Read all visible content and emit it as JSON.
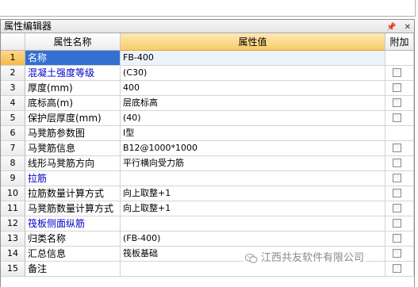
{
  "panel": {
    "title": "属性编辑器",
    "pin_icon": "pin-icon",
    "close_icon": "close-icon"
  },
  "table": {
    "headers": {
      "name": "属性名称",
      "value": "属性值",
      "add": "附加"
    },
    "rows": [
      {
        "num": "1",
        "name": "名称",
        "value": "FB-400",
        "link": true,
        "checkbox": false,
        "selected": true
      },
      {
        "num": "2",
        "name": "混凝土强度等级",
        "value": "(C30)",
        "link": true,
        "checkbox": true
      },
      {
        "num": "3",
        "name": "厚度(mm)",
        "value": "400",
        "link": false,
        "checkbox": true
      },
      {
        "num": "4",
        "name": "底标高(m)",
        "value": "层底标高",
        "link": false,
        "checkbox": true
      },
      {
        "num": "5",
        "name": "保护层厚度(mm)",
        "value": "(40)",
        "link": false,
        "checkbox": true
      },
      {
        "num": "6",
        "name": "马凳筋参数图",
        "value": "Ⅰ型",
        "link": false,
        "checkbox": false
      },
      {
        "num": "7",
        "name": "马凳筋信息",
        "value": "B12@1000*1000",
        "link": false,
        "checkbox": true
      },
      {
        "num": "8",
        "name": "线形马凳筋方向",
        "value": "平行横向受力筋",
        "link": false,
        "checkbox": true
      },
      {
        "num": "9",
        "name": "拉筋",
        "value": "",
        "link": true,
        "checkbox": true
      },
      {
        "num": "10",
        "name": "拉筋数量计算方式",
        "value": "向上取整+1",
        "link": false,
        "checkbox": true
      },
      {
        "num": "11",
        "name": "马凳筋数量计算方式",
        "value": "向上取整+1",
        "link": false,
        "checkbox": true
      },
      {
        "num": "12",
        "name": "筏板侧面纵筋",
        "value": "",
        "link": true,
        "checkbox": true
      },
      {
        "num": "13",
        "name": "归类名称",
        "value": "(FB-400)",
        "link": false,
        "checkbox": true
      },
      {
        "num": "14",
        "name": "汇总信息",
        "value": "筏板基础",
        "link": false,
        "checkbox": true
      },
      {
        "num": "15",
        "name": "备注",
        "value": "",
        "link": false,
        "checkbox": true
      }
    ]
  },
  "watermark": {
    "text": "江西共友软件有限公司",
    "icon": "wechat-icon"
  },
  "colors": {
    "link": "#0000c8",
    "selected_bg": "#3370d0",
    "header_value_bg": "#f8cc6a"
  }
}
